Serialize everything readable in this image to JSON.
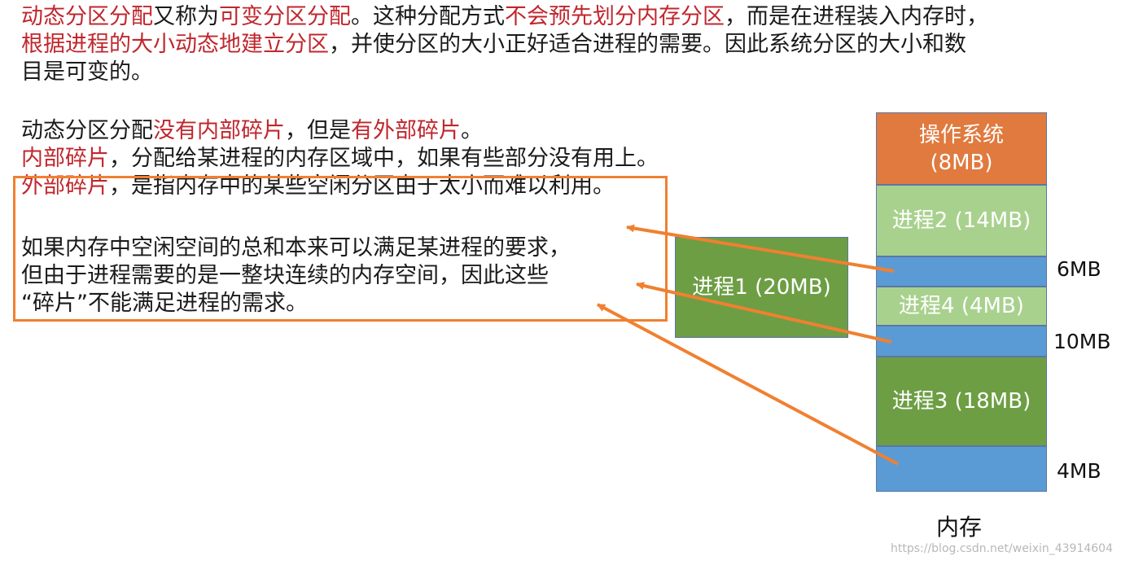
{
  "text": {
    "para1": [
      [
        "动态分区分配",
        true
      ],
      [
        "又称为",
        false
      ],
      [
        "可变分区分配",
        true
      ],
      [
        "。这种分配方式",
        false
      ],
      [
        "不会预先划分内存分区",
        true
      ],
      [
        "，而是在进程装入内存时，",
        false
      ]
    ],
    "para1_line2": [
      [
        "根据进程的大小动态地建立分区",
        true
      ],
      [
        "，并使分区的大小正好适合进程的需要。因此系统分区的大小和数",
        false
      ]
    ],
    "para1_line3": [
      [
        "目是可变的。",
        false
      ]
    ],
    "para2_line1": [
      [
        "动态分区分配",
        false
      ],
      [
        "没有内部碎片",
        true
      ],
      [
        "，但是",
        false
      ],
      [
        "有外部碎片",
        true
      ],
      [
        "。",
        false
      ]
    ],
    "para2_line2": [
      [
        "内部碎片",
        true
      ],
      [
        "，分配给某进程的内存区域中，如果有些部分没有用上。",
        false
      ]
    ],
    "para2_line3": [
      [
        "外部碎片",
        true
      ],
      [
        "，是指内存中的某些空闲分区由于太小而难以利用。",
        false
      ]
    ],
    "para3_lines": [
      "如果内存中空闲空间的总和本来可以满足某进程的要求，",
      "但由于进程需要的是一整块连续的内存空间，因此这些",
      "“碎片”不能满足进程的需求。"
    ]
  },
  "pending_process": {
    "label": "进程1 (20MB)",
    "color": "#6d9e44"
  },
  "memory": {
    "caption": "内存",
    "os_label_line1": "操作系统",
    "os_label_line2": "(8MB)",
    "blocks": [
      {
        "kind": "os",
        "color": "#e07a3e"
      },
      {
        "kind": "process",
        "label": "进程2 (14MB)",
        "color": "#a9d18e"
      },
      {
        "kind": "free",
        "size_label": "6MB",
        "color": "#5b9bd5"
      },
      {
        "kind": "process",
        "label": "进程4 (4MB)",
        "color": "#a9d18e"
      },
      {
        "kind": "free",
        "size_label": "10MB",
        "color": "#5b9bd5"
      },
      {
        "kind": "process",
        "label": "进程3 (18MB)",
        "color": "#6d9e44"
      },
      {
        "kind": "free",
        "size_label": "4MB",
        "color": "#5b9bd5"
      }
    ]
  },
  "colors": {
    "highlight_text": "#c0272d",
    "frame_and_arrows": "#f08030"
  },
  "watermark": "https://blog.csdn.net/weixin_43914604"
}
